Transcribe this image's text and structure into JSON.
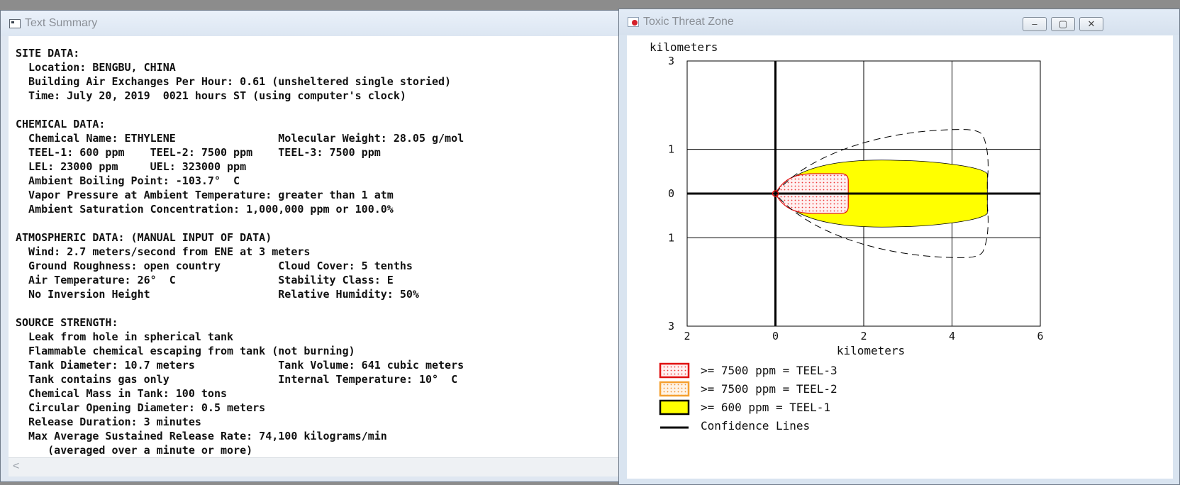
{
  "text_window": {
    "title": "Text Summary",
    "lines": [
      "SITE DATA:",
      "  Location: BENGBU, CHINA",
      "  Building Air Exchanges Per Hour: 0.61 (unsheltered single storied)",
      "  Time: July 20, 2019  0021 hours ST (using computer's clock)",
      "",
      "CHEMICAL DATA:",
      "  Chemical Name: ETHYLENE                Molecular Weight: 28.05 g/mol",
      "  TEEL-1: 600 ppm    TEEL-2: 7500 ppm    TEEL-3: 7500 ppm",
      "  LEL: 23000 ppm     UEL: 323000 ppm",
      "  Ambient Boiling Point: -103.7°  C",
      "  Vapor Pressure at Ambient Temperature: greater than 1 atm",
      "  Ambient Saturation Concentration: 1,000,000 ppm or 100.0%",
      "",
      "ATMOSPHERIC DATA: (MANUAL INPUT OF DATA)",
      "  Wind: 2.7 meters/second from ENE at 3 meters",
      "  Ground Roughness: open country         Cloud Cover: 5 tenths",
      "  Air Temperature: 26°  C                Stability Class: E",
      "  No Inversion Height                    Relative Humidity: 50%",
      "",
      "SOURCE STRENGTH:",
      "  Leak from hole in spherical tank",
      "  Flammable chemical escaping from tank (not burning)",
      "  Tank Diameter: 10.7 meters             Tank Volume: 641 cubic meters",
      "  Tank contains gas only                 Internal Temperature: 10°  C",
      "  Chemical Mass in Tank: 100 tons",
      "  Circular Opening Diameter: 0.5 meters",
      "  Release Duration: 3 minutes",
      "  Max Average Sustained Release Rate: 74,100 kilograms/min",
      "     (averaged over a minute or more)"
    ],
    "scroll_left": "<"
  },
  "plot_window": {
    "title": "Toxic Threat Zone",
    "buttons": {
      "minimize": "–",
      "maximize": "▢",
      "close": "✕"
    }
  },
  "chart_data": {
    "type": "area",
    "ylabel": "kilometers",
    "xlabel": "kilometers",
    "xlim": [
      -2,
      6
    ],
    "ylim": [
      -3,
      3
    ],
    "x_ticks": [
      "2",
      "0",
      "2",
      "4",
      "6"
    ],
    "y_ticks": [
      "3",
      "1",
      "0",
      "1",
      "3"
    ],
    "grid": true,
    "zones": [
      {
        "name": "TEEL-1 zone",
        "color": "#ffff00",
        "x_range": [
          0,
          4.8
        ],
        "half_width": 0.75
      },
      {
        "name": "TEEL-3 zone",
        "color": "#ffd6d6",
        "x_range": [
          0,
          1.65
        ],
        "half_width": 0.45
      },
      {
        "name": "Confidence Lines",
        "x_range": [
          0,
          4.8
        ],
        "half_width": 1.45
      }
    ],
    "legend": [
      {
        "label": ">= 7500 ppm = TEEL-3",
        "fill": "#ffe2e2",
        "border": "#e01010",
        "dotted": true
      },
      {
        "label": ">= 7500 ppm = TEEL-2",
        "fill": "#ffe0c0",
        "border": "#f5a030",
        "dotted": true
      },
      {
        "label": ">= 600 ppm = TEEL-1",
        "fill": "#ffff00",
        "border": "#000000",
        "dotted": false
      },
      {
        "label": "Confidence Lines",
        "line": true
      }
    ],
    "legend_position": "bottom-left"
  }
}
